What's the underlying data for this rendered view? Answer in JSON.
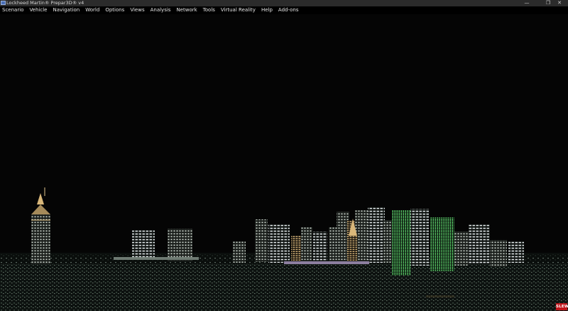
{
  "window": {
    "title": "Lockheed Martin® Prepar3D® v4",
    "minimize_glyph": "—",
    "maximize_glyph": "❐",
    "close_glyph": "✕"
  },
  "menu": [
    {
      "label": "Scenario"
    },
    {
      "label": "Vehicle"
    },
    {
      "label": "Navigation"
    },
    {
      "label": "World"
    },
    {
      "label": "Options"
    },
    {
      "label": "Views"
    },
    {
      "label": "Analysis"
    },
    {
      "label": "Network"
    },
    {
      "label": "Tools"
    },
    {
      "label": "Virtual Reality"
    },
    {
      "label": "Help"
    },
    {
      "label": "Add-ons"
    }
  ],
  "status": {
    "slew_label": "SLEW",
    "slew_color": "#c0141a"
  },
  "scene": {
    "icons": [
      "app-icon",
      "minimize-icon",
      "maximize-icon",
      "close-icon"
    ],
    "sky_color": "#050505"
  }
}
